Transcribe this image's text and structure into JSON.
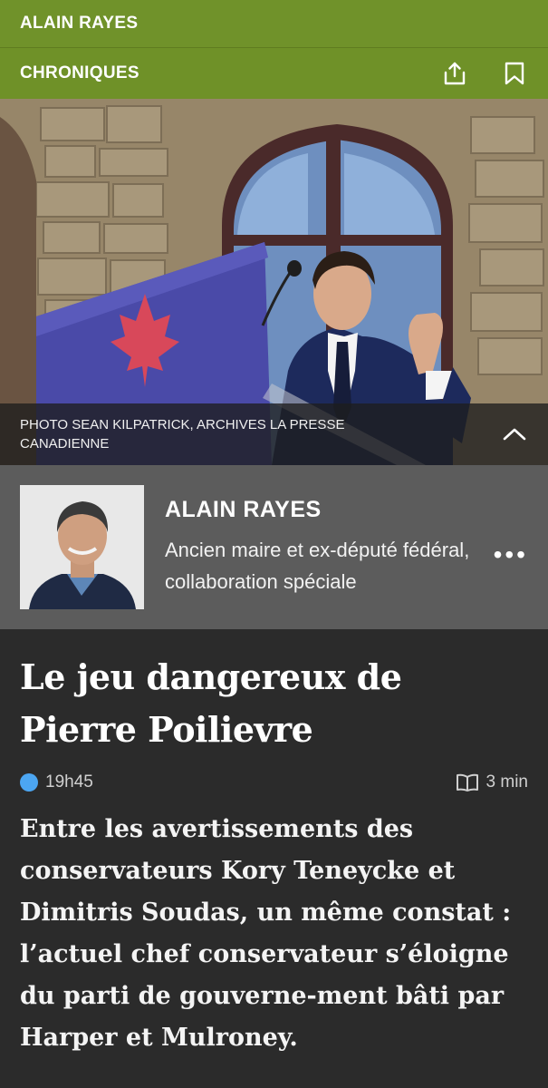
{
  "header": {
    "section_title": "ALAIN RAYES",
    "category": "CHRONIQUES",
    "share_icon": "share-icon",
    "bookmark_icon": "bookmark-icon"
  },
  "hero": {
    "caption": "PHOTO SEAN KILPATRICK, ARCHIVES LA PRESSE CANADIENNE",
    "collapse_icon": "chevron-up-icon"
  },
  "author": {
    "name": "ALAIN RAYES",
    "role": "Ancien maire et ex-député fédéral, collaboration spéciale",
    "more_icon": "more-icon"
  },
  "article": {
    "title": "Le jeu dangereux de Pierre Poilievre",
    "time": "19h45",
    "read_time": "3 min",
    "lede": "Entre les avertissements des conservateurs Kory Teneycke et Dimitris Soudas, un même constat : l’actuel chef conservateur s’éloigne du parti de gouverne-ment bâti par Harper et Mulroney."
  },
  "colors": {
    "accent_green": "#70922a",
    "new_dot_blue": "#4ca6f2"
  }
}
